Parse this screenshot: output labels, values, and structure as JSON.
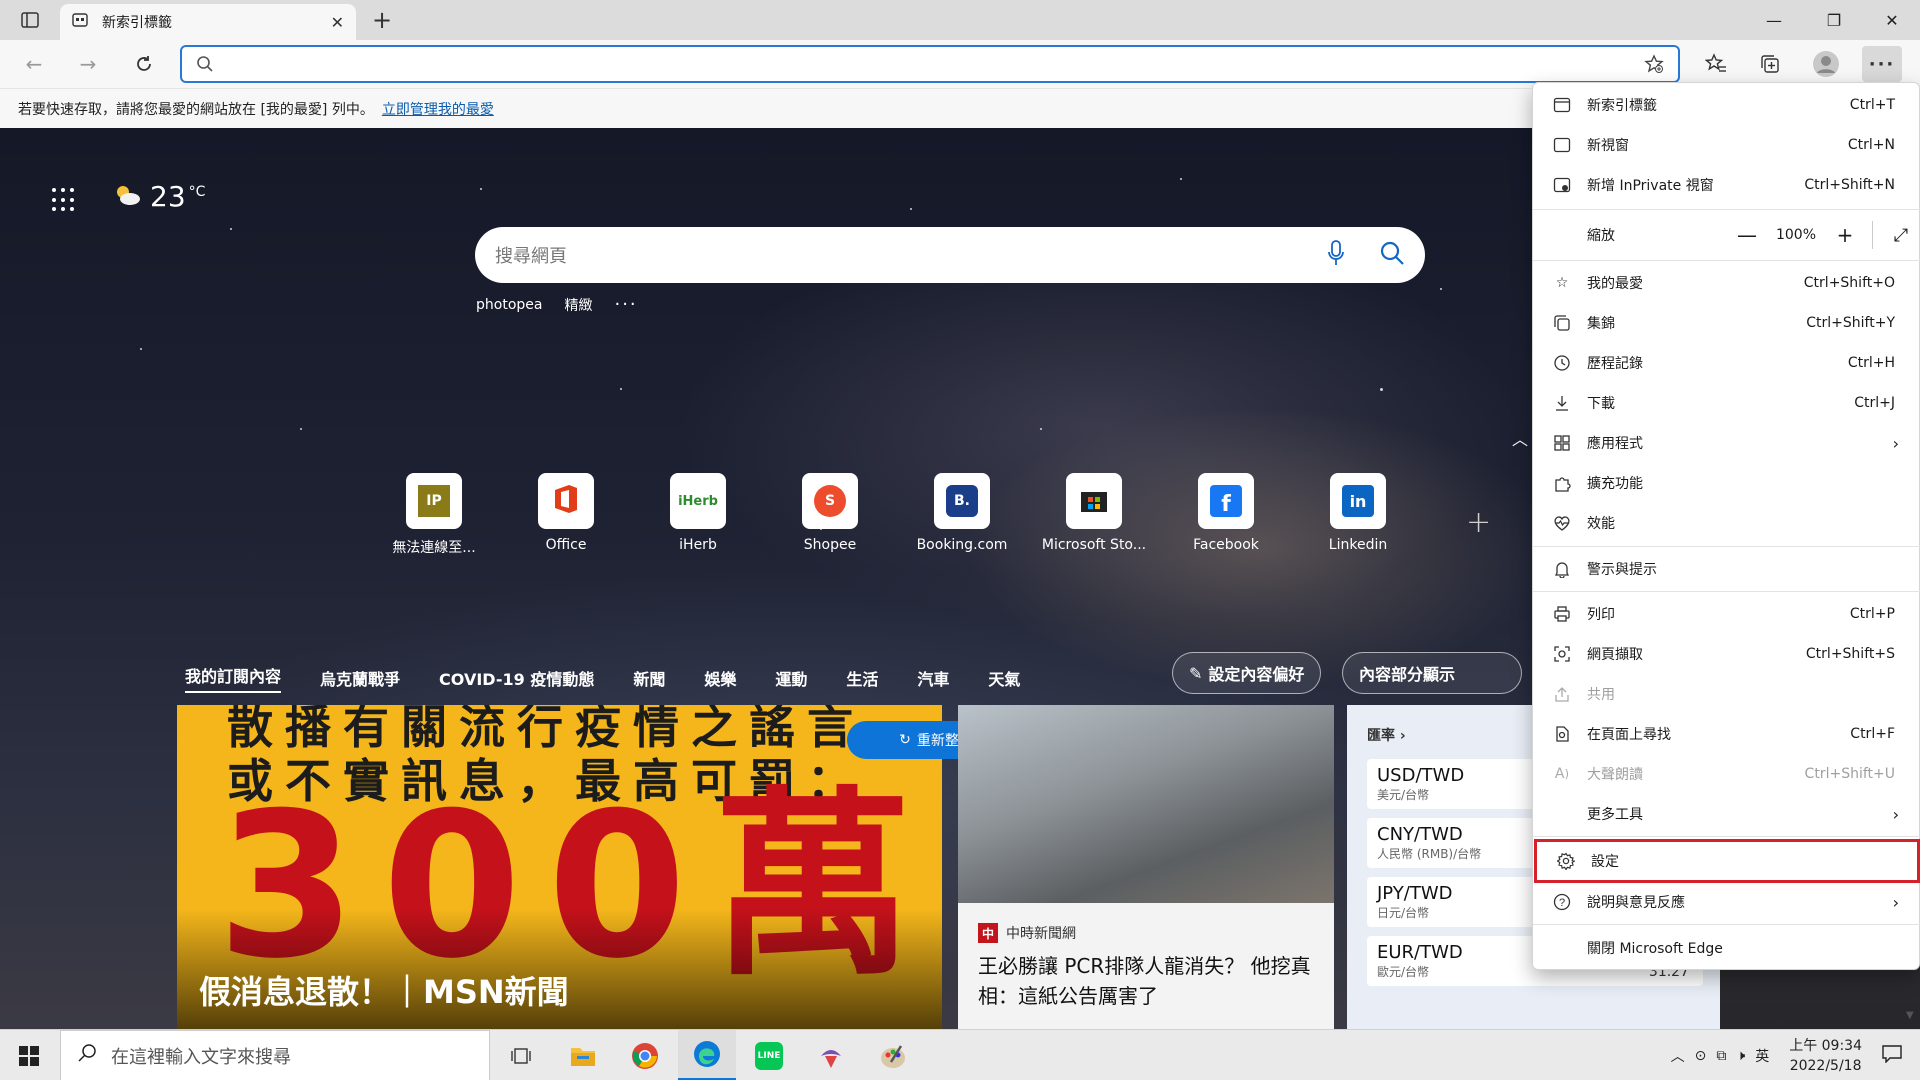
{
  "tab": {
    "title": "新索引標籤"
  },
  "favorites_bar": {
    "text": "若要快速存取，請將您最愛的網站放在 [我的最愛] 列中。",
    "link": "立即管理我的最愛"
  },
  "page": {
    "temperature": "23",
    "temp_unit": "°C",
    "search_placeholder": "搜尋網頁",
    "suggestions": [
      "photopea",
      "精緻",
      "···"
    ],
    "quick_links": [
      {
        "label": "無法連線至...",
        "icon": "ip-icon"
      },
      {
        "label": "Office",
        "icon": "office-icon"
      },
      {
        "label": "iHerb",
        "icon": "iherb-icon"
      },
      {
        "label": "Shopee",
        "icon": "shopee-icon"
      },
      {
        "label": "Booking.com",
        "icon": "booking-icon"
      },
      {
        "label": "Microsoft Sto...",
        "icon": "microsoft-store-icon"
      },
      {
        "label": "Facebook",
        "icon": "facebook-icon"
      },
      {
        "label": "Linkedin",
        "icon": "linkedin-icon"
      }
    ],
    "feed_tabs": [
      "我的訂閱內容",
      "烏克蘭戰爭",
      "COVID-19 疫情動態",
      "新聞",
      "娛樂",
      "運動",
      "生活",
      "汽車",
      "天氣"
    ],
    "personalize": "設定內容偏好",
    "partial_display": "內容部分顯示",
    "refresh": "重新整理故事",
    "main_card": {
      "line1": "散播有關流行疫情之謠言",
      "line2": "或不實訊息，最高可罰：",
      "big": "300萬",
      "headline": "假消息退散！｜MSN新聞"
    },
    "news_card": {
      "source": "中時新聞網",
      "source_logo": "中",
      "title": "王必勝讓 PCR排隊人龍消失？ 他挖真相：這紙公告厲害了"
    },
    "fx_card": {
      "header": "匯率",
      "rates": [
        {
          "pair": "USD/TWD",
          "desc": "美元/台幣",
          "value": ""
        },
        {
          "pair": "CNY/TWD",
          "desc": "人民幣 (RMB)/台幣",
          "value": ""
        },
        {
          "pair": "JPY/TWD",
          "desc": "日元/台幣",
          "value": ""
        },
        {
          "pair": "EUR/TWD",
          "desc": "歐元/台幣",
          "value": "31.27"
        }
      ]
    }
  },
  "menu": {
    "items": [
      {
        "label": "新索引標籤",
        "shortcut": "Ctrl+T",
        "icon": "new-tab-icon"
      },
      {
        "label": "新視窗",
        "shortcut": "Ctrl+N",
        "icon": "new-window-icon"
      },
      {
        "label": "新增 InPrivate 視窗",
        "shortcut": "Ctrl+Shift+N",
        "icon": "inprivate-icon"
      },
      {
        "label": "我的最愛",
        "shortcut": "Ctrl+Shift+O",
        "icon": "favorites-icon"
      },
      {
        "label": "集錦",
        "shortcut": "Ctrl+Shift+Y",
        "icon": "collections-icon"
      },
      {
        "label": "歷程記錄",
        "shortcut": "Ctrl+H",
        "icon": "history-icon"
      },
      {
        "label": "下載",
        "shortcut": "Ctrl+J",
        "icon": "download-icon"
      },
      {
        "label": "應用程式",
        "shortcut": "",
        "icon": "apps-icon"
      },
      {
        "label": "擴充功能",
        "shortcut": "",
        "icon": "extensions-icon"
      },
      {
        "label": "效能",
        "shortcut": "",
        "icon": "performance-icon"
      },
      {
        "label": "警示與提示",
        "shortcut": "",
        "icon": "bell-icon"
      },
      {
        "label": "列印",
        "shortcut": "Ctrl+P",
        "icon": "print-icon"
      },
      {
        "label": "網頁擷取",
        "shortcut": "Ctrl+Shift+S",
        "icon": "web-capture-icon"
      },
      {
        "label": "共用",
        "shortcut": "",
        "icon": "share-icon"
      },
      {
        "label": "在頁面上尋找",
        "shortcut": "Ctrl+F",
        "icon": "find-icon"
      },
      {
        "label": "大聲朗讀",
        "shortcut": "Ctrl+Shift+U",
        "icon": "read-aloud-icon"
      },
      {
        "label": "更多工具",
        "shortcut": "",
        "icon": ""
      },
      {
        "label": "設定",
        "shortcut": "",
        "icon": "settings-icon"
      },
      {
        "label": "說明與意見反應",
        "shortcut": "",
        "icon": "help-icon"
      },
      {
        "label": "關閉 Microsoft Edge",
        "shortcut": "",
        "icon": ""
      }
    ],
    "zoom_label": "縮放",
    "zoom_value": "100%",
    "zoom_minus": "—",
    "zoom_plus": "+"
  },
  "taskbar": {
    "search_placeholder": "在這裡輸入文字來搜尋",
    "ime": "英",
    "time": "上午 09:34",
    "date": "2022/5/18"
  },
  "colors": {
    "accent": "#0e74d8",
    "highlight": "#d6202b"
  }
}
